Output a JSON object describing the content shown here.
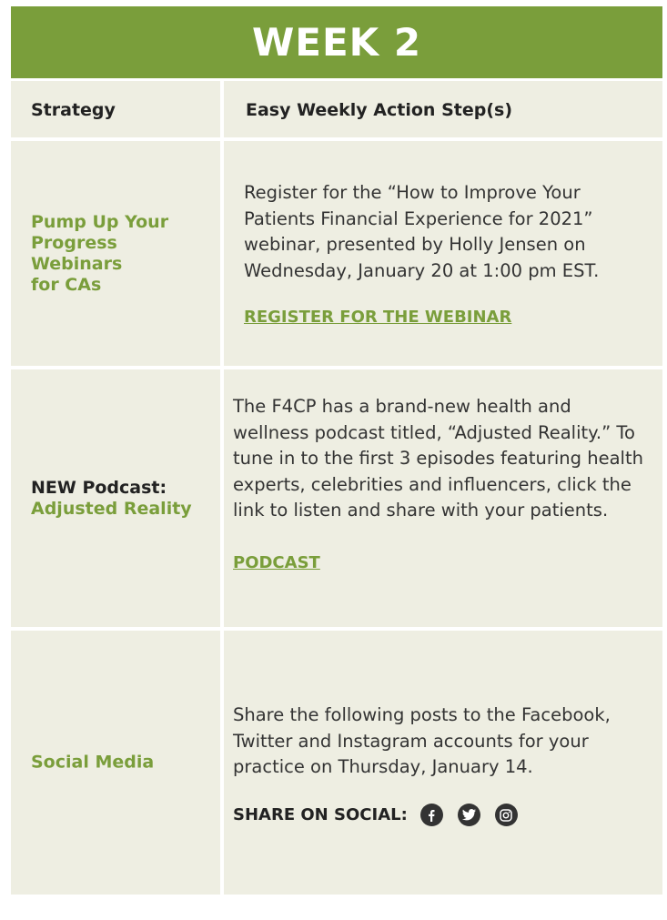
{
  "banner": {
    "title": "WEEK 2"
  },
  "table": {
    "header": {
      "strategy": "Strategy",
      "action": "Easy Weekly Action Step(s)"
    },
    "rows": [
      {
        "strategy_lines": [
          "Pump Up Your",
          "Progress",
          "Webinars",
          "for CAs"
        ],
        "action_lines": [
          "Register for the “How to Improve Your",
          "Patients Financial Experience for 2021”",
          "webinar, presented by Holly Jensen on",
          "Wednesday, January 20 at 1:00 pm EST."
        ],
        "link": "REGISTER FOR THE WEBINAR"
      },
      {
        "strategy_prefix": "NEW Podcast:",
        "strategy_main": "Adjusted Reality",
        "action_lines": [
          "The F4CP has a brand-new health and",
          "wellness podcast titled, “Adjusted Reality.” To",
          "tune in to the first 3 episodes featuring health",
          "experts, celebrities and influencers, click the",
          "link to listen and share with your patients."
        ],
        "link": "PODCAST"
      },
      {
        "strategy": "Social Media",
        "action_lines": [
          "Share the following posts to the Facebook,",
          "Twitter and Instagram accounts for your",
          "practice on Thursday, January 14."
        ],
        "share_label": "SHARE ON SOCIAL:",
        "icons": [
          "facebook-icon",
          "twitter-icon",
          "instagram-icon"
        ]
      }
    ]
  },
  "colors": {
    "accent": "#7a9e3b",
    "cell": "#eeeee2",
    "text": "#333333"
  }
}
